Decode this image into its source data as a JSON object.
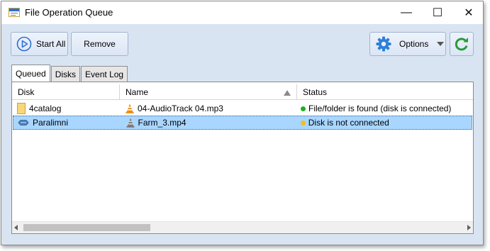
{
  "window": {
    "title": "File Operation Queue",
    "min_glyph": "—",
    "max_glyph": "☐",
    "close_glyph": "✕"
  },
  "toolbar": {
    "start_all_label": "Start All",
    "remove_label": "Remove",
    "options_label": "Options"
  },
  "tabs": [
    {
      "label": "Queued",
      "active": true
    },
    {
      "label": "Disks",
      "active": false
    },
    {
      "label": "Event Log",
      "active": false
    }
  ],
  "grid": {
    "columns": [
      "Disk",
      "Name",
      "Status"
    ],
    "sorted_column": "Name",
    "sort_direction": "ascending",
    "rows": [
      {
        "disk": "4catalog",
        "disk_icon": "folder-icon",
        "name": "04-AudioTrack 04.mp3",
        "name_icon": "vlc-cone-icon",
        "status": "File/folder is found (disk is connected)",
        "status_color": "#20b020",
        "selected": false
      },
      {
        "disk": "Paralimni",
        "disk_icon": "disk-icon",
        "name": "Farm_3.mp4",
        "name_icon": "vlc-cone-gray-icon",
        "status": "Disk is not connected",
        "status_color": "#f0c020",
        "selected": true
      }
    ]
  },
  "colors": {
    "accent": "#2f6fd3",
    "selection": "#a9d6ff",
    "refresh_green": "#2a9a3a"
  }
}
